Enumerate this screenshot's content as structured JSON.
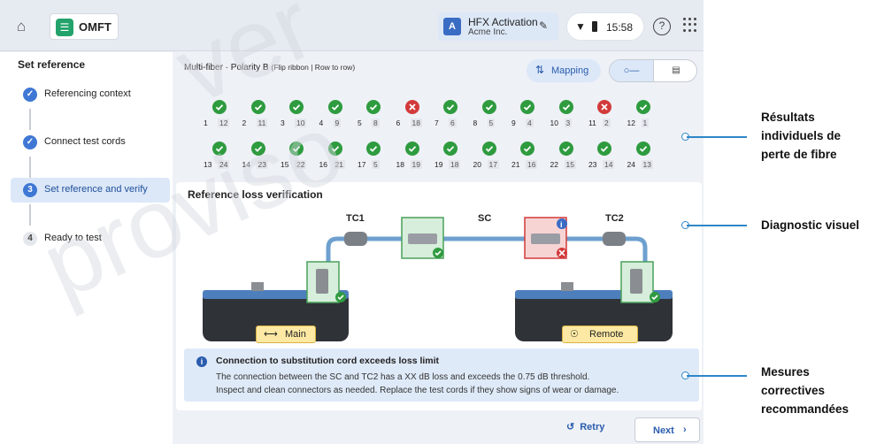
{
  "topbar": {
    "app_name": "OMFT",
    "account_name": "HFX Activation",
    "account_org": "Acme Inc.",
    "account_initial": "A",
    "time": "15:58"
  },
  "sidebar": {
    "title": "Set reference",
    "steps": [
      {
        "label": "Referencing context",
        "state": "done"
      },
      {
        "label": "Connect test cords",
        "state": "done"
      },
      {
        "label": "Set reference and verify",
        "state": "active",
        "number": "3"
      },
      {
        "label": "Ready to test",
        "state": "pending",
        "number": "4"
      }
    ]
  },
  "header": {
    "fiber_config": "Multi-fiber · Polarity B",
    "fiber_config_detail": "(Flip ribbon | Row to row)",
    "mapping_label": "Mapping"
  },
  "fibers_row1": [
    {
      "a": "1",
      "b": "12",
      "status": "pass"
    },
    {
      "a": "2",
      "b": "11",
      "status": "pass"
    },
    {
      "a": "3",
      "b": "10",
      "status": "pass"
    },
    {
      "a": "4",
      "b": "9",
      "status": "pass"
    },
    {
      "a": "5",
      "b": "8",
      "status": "pass"
    },
    {
      "a": "6",
      "b": "18",
      "status": "fail"
    },
    {
      "a": "7",
      "b": "6",
      "status": "pass"
    },
    {
      "a": "8",
      "b": "5",
      "status": "pass"
    },
    {
      "a": "9",
      "b": "4",
      "status": "pass"
    },
    {
      "a": "10",
      "b": "3",
      "status": "pass"
    },
    {
      "a": "11",
      "b": "2",
      "status": "fail"
    },
    {
      "a": "12",
      "b": "1",
      "status": "pass"
    }
  ],
  "fibers_row2": [
    {
      "a": "13",
      "b": "24",
      "status": "pass"
    },
    {
      "a": "14",
      "b": "23",
      "status": "pass"
    },
    {
      "a": "15",
      "b": "22",
      "status": "pass"
    },
    {
      "a": "16",
      "b": "21",
      "status": "pass"
    },
    {
      "a": "17",
      "b": "5",
      "status": "pass"
    },
    {
      "a": "18",
      "b": "19",
      "status": "pass"
    },
    {
      "a": "19",
      "b": "18",
      "status": "pass"
    },
    {
      "a": "20",
      "b": "17",
      "status": "pass"
    },
    {
      "a": "21",
      "b": "16",
      "status": "pass"
    },
    {
      "a": "22",
      "b": "15",
      "status": "pass"
    },
    {
      "a": "23",
      "b": "14",
      "status": "pass"
    },
    {
      "a": "24",
      "b": "13",
      "status": "pass"
    }
  ],
  "diagram": {
    "title": "Reference loss verification",
    "tc1": "TC1",
    "sc": "SC",
    "tc2": "TC2",
    "main_label": "Main",
    "remote_label": "Remote"
  },
  "alert": {
    "title": "Connection to substitution cord exceeds loss limit",
    "line1": "The connection between the SC and TC2 has a XX dB loss and exceeds the 0.75 dB threshold.",
    "line2": "Inspect and clean connectors as needed. Replace the test cords if they show signs of wear or damage."
  },
  "footer": {
    "retry_label": "Retry",
    "next_label": "Next"
  },
  "callouts": {
    "c1_line1": "Résultats",
    "c1_line2": "individuels de",
    "c1_line3": "perte de fibre",
    "c2": "Diagnostic visuel",
    "c3_line1": "Mesures",
    "c3_line2": "correctives",
    "c3_line3": "recommandées"
  },
  "watermark": {
    "word1": "ver",
    "word2": "proviso"
  },
  "colors": {
    "pass": "#2e9b3f",
    "fail": "#d23a3a",
    "accent": "#2a5cad",
    "callout": "#2e87c8"
  }
}
